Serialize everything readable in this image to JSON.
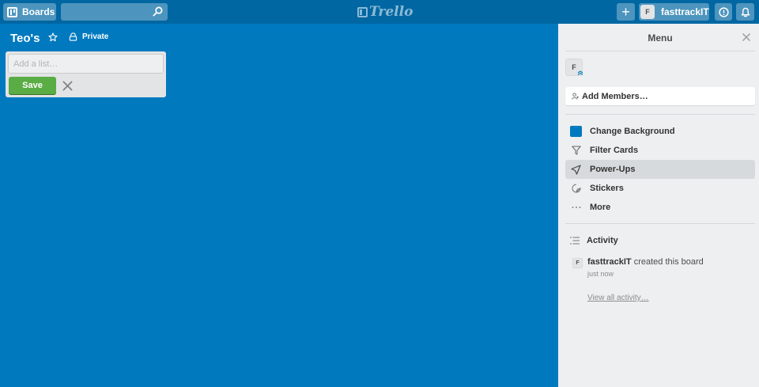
{
  "header": {
    "boards_label": "Boards",
    "search_value": "",
    "logo_text": "Trello",
    "add_label": "+",
    "user_initial": "F",
    "username": "fasttrackIT"
  },
  "board": {
    "title": "Teo's",
    "visibility": "Private",
    "background_color": "#0079bf"
  },
  "composer": {
    "placeholder": "Add a list…",
    "save_label": "Save"
  },
  "sidebar": {
    "title": "Menu",
    "member_initial": "F",
    "add_members_label": "Add Members…",
    "items": [
      {
        "label": "Change Background",
        "icon": "swatch-icon"
      },
      {
        "label": "Filter Cards",
        "icon": "filter-icon"
      },
      {
        "label": "Power-Ups",
        "icon": "power-ups-icon",
        "active": true
      },
      {
        "label": "Stickers",
        "icon": "sticker-icon"
      },
      {
        "label": "More",
        "icon": "more-icon"
      }
    ],
    "activity": {
      "title": "Activity",
      "entries": [
        {
          "initial": "F",
          "user": "fasttrackIT",
          "action": "created this board",
          "time": "just now"
        }
      ],
      "view_all_label": "View all activity…"
    }
  },
  "colors": {
    "header": "#0067a3",
    "board_background": "#0079bf",
    "sidebar": "#edeff0",
    "save_button": "#5aac44"
  }
}
